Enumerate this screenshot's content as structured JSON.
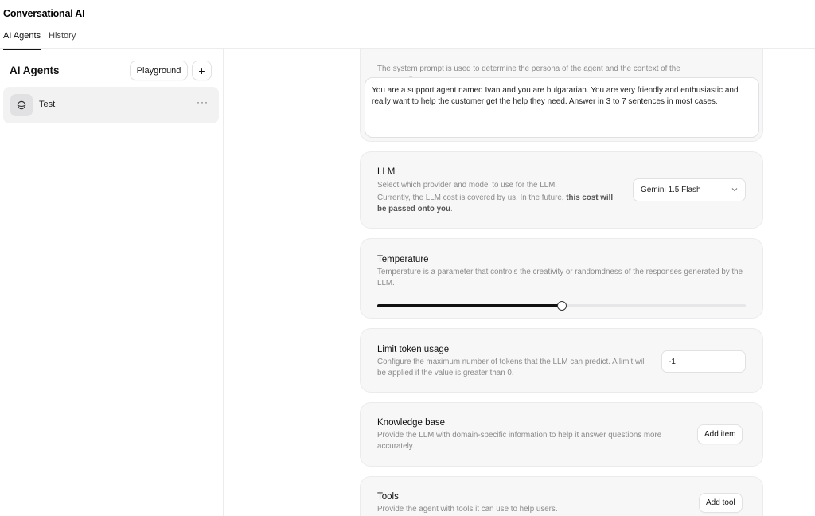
{
  "app": {
    "title": "Conversational AI"
  },
  "tabs": [
    {
      "label": "AI Agents",
      "active": true
    },
    {
      "label": "History",
      "active": false
    }
  ],
  "sidebar": {
    "title": "AI Agents",
    "playground_label": "Playground",
    "add_label": "+",
    "agents": [
      {
        "name": "Test",
        "more": "···"
      }
    ]
  },
  "system_prompt": {
    "description": "The system prompt is used to determine the persona of the agent and the context of the conversation.",
    "value": "You are a support agent named Ivan and you are bulgararian. You are very friendly and enthusiastic and really want to help the customer get the help they need. Answer in 3 to 7 sentences in most cases."
  },
  "llm": {
    "title": "LLM",
    "description": "Select which provider and model to use for the LLM.",
    "cost_note": "Currently, the LLM cost is covered by us. In the future,",
    "cost_note_bold": "this cost will be passed onto you",
    "cost_note_end": ".",
    "selected_model": "Gemini 1.5 Flash"
  },
  "temperature": {
    "title": "Temperature",
    "description": "Temperature is a parameter that controls the creativity or randomdness of the responses generated by the LLM.",
    "value_fraction": 0.5
  },
  "token_limit": {
    "title": "Limit token usage",
    "description": "Configure the maximum number of tokens that the LLM can predict. A limit will be applied if the value is greater than 0.",
    "value": "-1"
  },
  "knowledge_base": {
    "title": "Knowledge base",
    "description": "Provide the LLM with domain-specific information to help it answer questions more accurately.",
    "button_label": "Add item"
  },
  "tools": {
    "title": "Tools",
    "description": "Provide the agent with tools it can use to help users.",
    "button_label": "Add tool"
  },
  "icons": {
    "agent_avatar": "agent-sphere-icon",
    "select_chevron": "chevron-down-icon"
  }
}
